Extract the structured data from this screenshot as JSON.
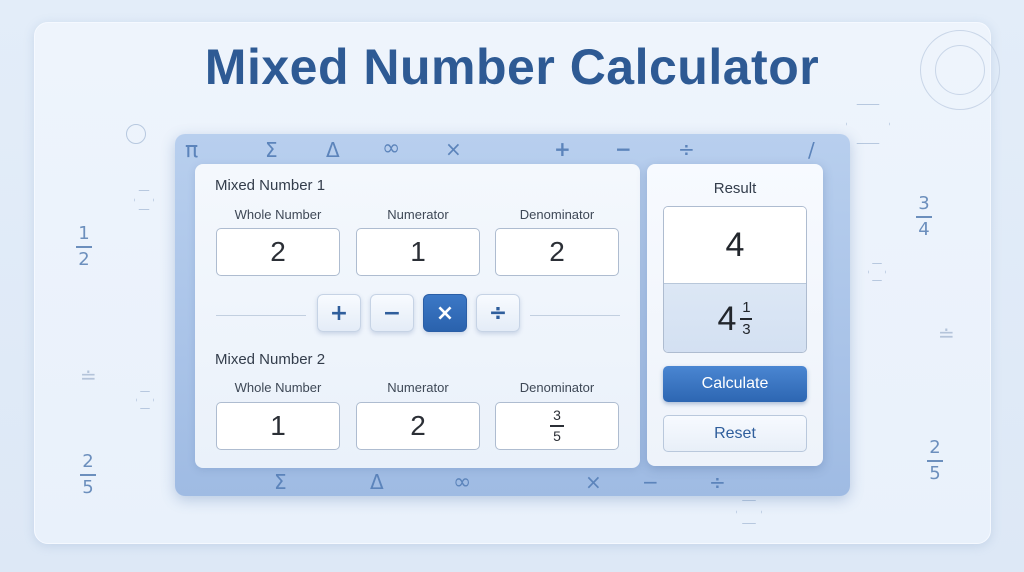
{
  "title": "Mixed Number Calculator",
  "background_decor": {
    "left_fracs": [
      {
        "num": "1",
        "den": "2"
      },
      {
        "num": "2",
        "den": "5"
      }
    ],
    "right_fracs": [
      {
        "num": "3",
        "den": "4"
      },
      {
        "num": "2",
        "den": "5"
      }
    ]
  },
  "frame_symbols_top": [
    "π",
    "Σ",
    "Δ",
    "∞",
    "×",
    "+",
    "−",
    "÷",
    "/"
  ],
  "frame_symbols_bottom": [
    "Σ",
    "Δ",
    "∞",
    "×",
    "−",
    "÷"
  ],
  "mixed_number_1": {
    "title": "Mixed Number 1",
    "whole_label": "Whole Number",
    "numerator_label": "Numerator",
    "denominator_label": "Denominator",
    "whole": "2",
    "numerator": "1",
    "denominator": "2"
  },
  "operators": {
    "add": "+",
    "subtract": "−",
    "multiply": "×",
    "divide": "÷",
    "selected": "multiply"
  },
  "mixed_number_2": {
    "title": "Mixed Number 2",
    "whole_label": "Whole Number",
    "numerator_label": "Numerator",
    "denominator_label": "Denominator",
    "whole": "1",
    "numerator": "2",
    "denominator_num": "3",
    "denominator_den": "5"
  },
  "result": {
    "label": "Result",
    "value": "4",
    "mixed_whole": "4",
    "mixed_num": "1",
    "mixed_den": "3"
  },
  "buttons": {
    "calculate": "Calculate",
    "reset": "Reset"
  },
  "colors": {
    "accent": "#2d66b2",
    "title": "#2e5a94",
    "frame": "#a9c3e8"
  }
}
